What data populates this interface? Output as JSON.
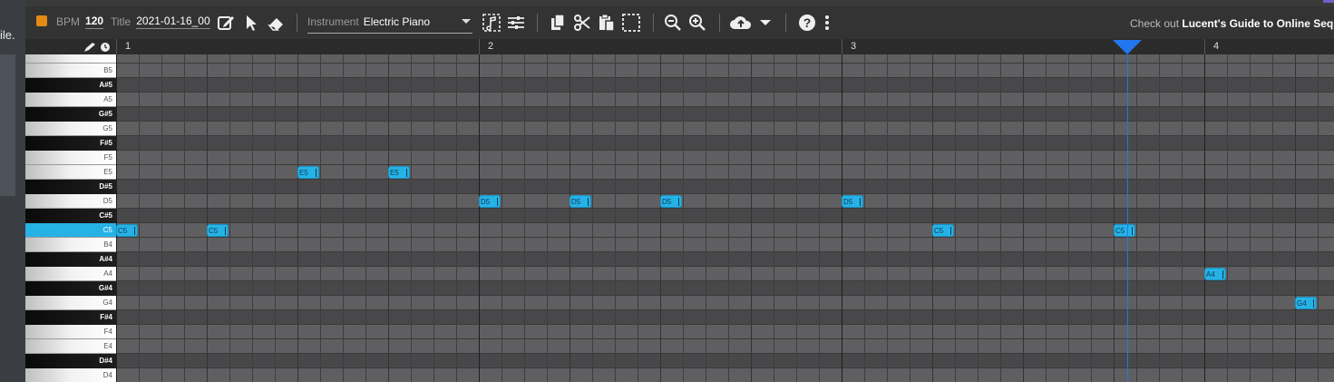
{
  "left_strip_text": "ile.",
  "toolbar": {
    "bpm_label": "BPM",
    "bpm_value": "120",
    "title_label": "Title",
    "title_value": "2021-01-16_00",
    "instrument_label": "Instrument",
    "instrument_value": "Electric Piano",
    "promo_prefix": "Check out ",
    "promo_link": "Lucent's Guide to Online Sequenc",
    "colors": {
      "record": "#e38a12",
      "accent": "#27b2e6",
      "playhead": "#2277ee"
    }
  },
  "timeline": {
    "bars": [
      "1",
      "2",
      "3",
      "4"
    ]
  },
  "keys": [
    {
      "label": "",
      "type": "white"
    },
    {
      "label": "B5",
      "type": "white"
    },
    {
      "label": "A#5",
      "type": "black"
    },
    {
      "label": "A5",
      "type": "white"
    },
    {
      "label": "G#5",
      "type": "black"
    },
    {
      "label": "G5",
      "type": "white"
    },
    {
      "label": "F#5",
      "type": "black"
    },
    {
      "label": "F5",
      "type": "white"
    },
    {
      "label": "E5",
      "type": "white"
    },
    {
      "label": "D#5",
      "type": "black"
    },
    {
      "label": "D5",
      "type": "white"
    },
    {
      "label": "C#5",
      "type": "black"
    },
    {
      "label": "C5",
      "type": "white",
      "active": true
    },
    {
      "label": "B4",
      "type": "white"
    },
    {
      "label": "A#4",
      "type": "black"
    },
    {
      "label": "A4",
      "type": "white"
    },
    {
      "label": "G#4",
      "type": "black"
    },
    {
      "label": "G4",
      "type": "white"
    },
    {
      "label": "F#4",
      "type": "black"
    },
    {
      "label": "F4",
      "type": "white"
    },
    {
      "label": "E4",
      "type": "white"
    },
    {
      "label": "D#4",
      "type": "black"
    },
    {
      "label": "D4",
      "type": "white"
    }
  ],
  "notes": [
    {
      "label": "C5",
      "pitch": "C5",
      "step": 0
    },
    {
      "label": "C5",
      "pitch": "C5",
      "step": 4
    },
    {
      "label": "E5",
      "pitch": "E5",
      "step": 8
    },
    {
      "label": "E5",
      "pitch": "E5",
      "step": 12
    },
    {
      "label": "D5",
      "pitch": "D5",
      "step": 16
    },
    {
      "label": "D5",
      "pitch": "D5",
      "step": 20
    },
    {
      "label": "D5",
      "pitch": "D5",
      "step": 24
    },
    {
      "label": "D5",
      "pitch": "D5",
      "step": 32
    },
    {
      "label": "C5",
      "pitch": "C5",
      "step": 36
    },
    {
      "label": "C5",
      "pitch": "C5",
      "step": 44
    },
    {
      "label": "A4",
      "pitch": "A4",
      "step": 48
    },
    {
      "label": "G4",
      "pitch": "G4",
      "step": 52
    }
  ],
  "playhead_step": 44.6
}
